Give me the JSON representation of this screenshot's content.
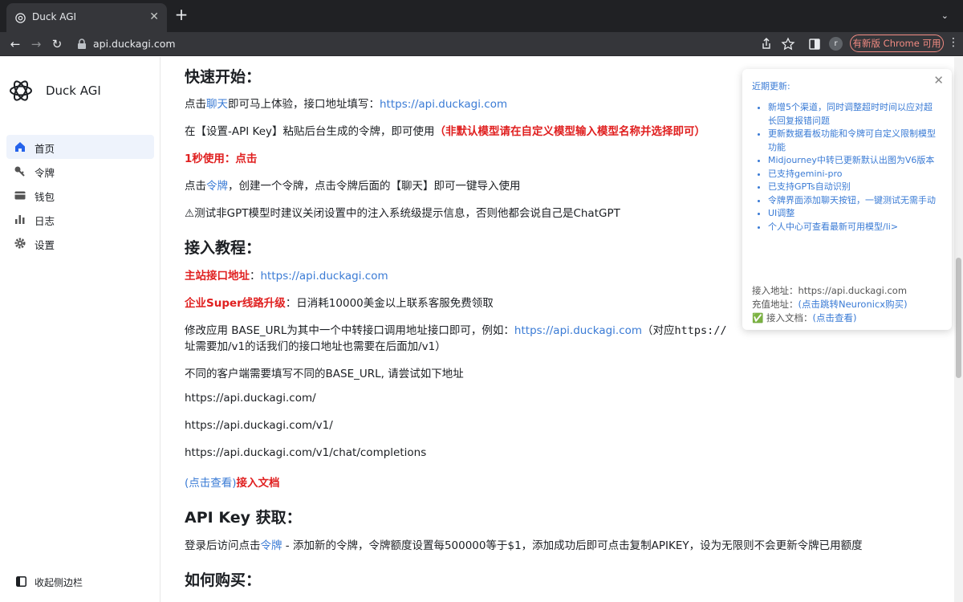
{
  "browser": {
    "tab_title": "Duck AGI",
    "url": "api.duckagi.com",
    "avatar_letter": "r",
    "update_label": "有新版 Chrome 可用"
  },
  "sidebar": {
    "brand": "Duck AGI",
    "items": [
      {
        "label": "首页",
        "icon": "home-icon",
        "active": true
      },
      {
        "label": "令牌",
        "icon": "key-icon",
        "active": false
      },
      {
        "label": "钱包",
        "icon": "wallet-icon",
        "active": false
      },
      {
        "label": "日志",
        "icon": "bar-chart-icon",
        "active": false
      },
      {
        "label": "设置",
        "icon": "gear-icon",
        "active": false
      }
    ],
    "collapse_label": "收起侧边栏"
  },
  "content": {
    "quickstart_title": "快速开始：",
    "l1_pre": "点击",
    "l1_link": "聊天",
    "l1_mid": "即可马上体验，接口地址填写：",
    "l1_url": "https://api.duckagi.com",
    "l2_pre": "在【设置-API Key】粘贴后台生成的令牌，即可使用",
    "l2_red": "（非默认模型请在自定义模型输入模型名称并选择即可）",
    "l3_red_a": "1秒使用：",
    "l3_red_b": "点击",
    "l4_pre": "点击",
    "l4_link": "令牌",
    "l4_post": "，创建一个令牌，点击令牌后面的【聊天】即可一键导入使用",
    "l5": "⚠测试非GPT模型时建议关闭设置中的注入系统级提示信息，否则他都会说自己是ChatGPT",
    "tutorial_title": "接入教程：",
    "t1_red": "主站接口地址",
    "t1_colon": "：",
    "t1_url": "https://api.duckagi.com",
    "t2_red": "企业Super线路升级",
    "t2_post": "：日消耗10000美金以上联系客服免费领取",
    "t3_pre": "修改应用 BASE_URL为其中一个中转接口调用地址接口即可，例如：",
    "t3_url": "https://api.duckagi.com",
    "t3_post": "（对应",
    "t3_mono": "https://",
    "t3_line2": "址需要加/v1的话我们的接口地址也需要在后面加/v1）",
    "t4": "不同的客户端需要填写不同的BASE_URL, 请尝试如下地址",
    "url_a": "https://api.duckagi.com/",
    "url_b": "https://api.duckagi.com/v1/",
    "url_c": "https://api.duckagi.com/v1/chat/completions",
    "doc_link": "(点击查看)",
    "doc_red": "接入文档",
    "apikey_title": "API Key 获取：",
    "k1_pre": "登录后访问点击",
    "k1_link": "令牌",
    "k1_post": " - 添加新的令牌，令牌额度设置每500000等于$1，添加成功后即可点击复制APIKEY，设为无限则不会更新令牌已用额度",
    "buy_title": "如何购买："
  },
  "notice": {
    "title": "近期更新:",
    "items": [
      "新增5个渠道，同时调整超时时间以应对超长回复报错问题",
      "更新数据看板功能和令牌可自定义限制模型功能",
      "Midjourney中转已更新默认出图为V6版本",
      "已支持gemini-pro",
      "已支持GPTs自动识别",
      "令牌界面添加聊天按钮，一键测试无需手动",
      "UI调整",
      "个人中心可查看最新可用模型/li>"
    ],
    "api_label": "接入地址：",
    "api_value": "https://api.duckagi.com",
    "recharge_label": "充值地址：",
    "recharge_link": "(点击跳转Neuronicx购买)",
    "doc_label": "✅ 接入文档：",
    "doc_link": "(点击查看)"
  },
  "colors": {
    "link": "#3a7bd5",
    "red": "#e02020",
    "active_bg": "#eef3fc",
    "chrome_dark": "#202124"
  }
}
